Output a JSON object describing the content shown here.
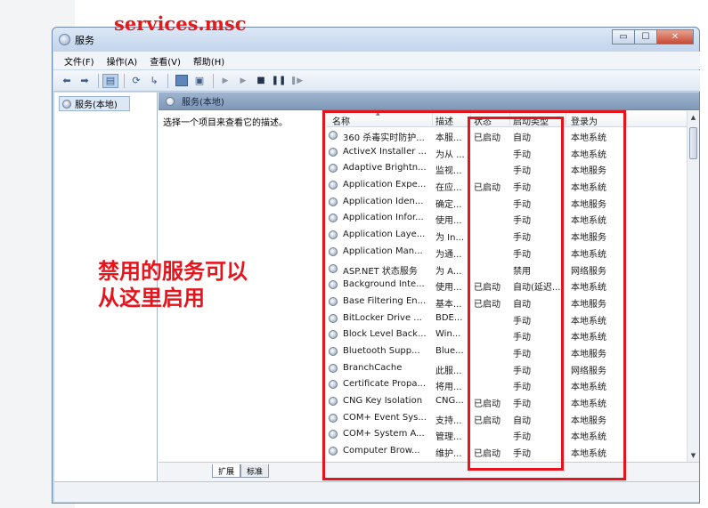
{
  "overlay_title": "services.msc",
  "annotation_line1": "禁用的服务可以",
  "annotation_line2": "从这里启用",
  "window": {
    "title": "服务",
    "min_label": "▭",
    "max_label": "☐",
    "close_label": "✕"
  },
  "menu": [
    "文件(F)",
    "操作(A)",
    "查看(V)",
    "帮助(H)"
  ],
  "tree_item": "服务(本地)",
  "pane_header": "服务(本地)",
  "description_prompt": "选择一个项目来查看它的描述。",
  "columns": {
    "name": "名称",
    "desc": "描述",
    "status": "状态",
    "startup": "启动类型",
    "logon": "登录为"
  },
  "services": [
    {
      "name": "360 杀毒实时防护...",
      "desc": "本服...",
      "status": "已启动",
      "startup": "自动",
      "logon": "本地系统"
    },
    {
      "name": "ActiveX Installer ...",
      "desc": "为从 ...",
      "status": "",
      "startup": "手动",
      "logon": "本地系统"
    },
    {
      "name": "Adaptive Brightn...",
      "desc": "监视...",
      "status": "",
      "startup": "手动",
      "logon": "本地服务"
    },
    {
      "name": "Application Expe...",
      "desc": "在应...",
      "status": "已启动",
      "startup": "手动",
      "logon": "本地系统"
    },
    {
      "name": "Application Iden...",
      "desc": "确定...",
      "status": "",
      "startup": "手动",
      "logon": "本地服务"
    },
    {
      "name": "Application Infor...",
      "desc": "使用...",
      "status": "",
      "startup": "手动",
      "logon": "本地系统"
    },
    {
      "name": "Application Laye...",
      "desc": "为 In...",
      "status": "",
      "startup": "手动",
      "logon": "本地服务"
    },
    {
      "name": "Application Man...",
      "desc": "为通...",
      "status": "",
      "startup": "手动",
      "logon": "本地系统"
    },
    {
      "name": "ASP.NET 状态服务",
      "desc": "为 A...",
      "status": "",
      "startup": "禁用",
      "logon": "网络服务"
    },
    {
      "name": "Background Inte...",
      "desc": "使用...",
      "status": "已启动",
      "startup": "自动(延迟...",
      "logon": "本地系统"
    },
    {
      "name": "Base Filtering En...",
      "desc": "基本...",
      "status": "已启动",
      "startup": "自动",
      "logon": "本地服务"
    },
    {
      "name": "BitLocker Drive ...",
      "desc": "BDE...",
      "status": "",
      "startup": "手动",
      "logon": "本地系统"
    },
    {
      "name": "Block Level Back...",
      "desc": "Win...",
      "status": "",
      "startup": "手动",
      "logon": "本地系统"
    },
    {
      "name": "Bluetooth Supp...",
      "desc": "Blue...",
      "status": "",
      "startup": "手动",
      "logon": "本地服务"
    },
    {
      "name": "BranchCache",
      "desc": "此服...",
      "status": "",
      "startup": "手动",
      "logon": "网络服务"
    },
    {
      "name": "Certificate Propa...",
      "desc": "将用...",
      "status": "",
      "startup": "手动",
      "logon": "本地系统"
    },
    {
      "name": "CNG Key Isolation",
      "desc": "CNG...",
      "status": "已启动",
      "startup": "手动",
      "logon": "本地系统"
    },
    {
      "name": "COM+ Event Sys...",
      "desc": "支持...",
      "status": "已启动",
      "startup": "自动",
      "logon": "本地服务"
    },
    {
      "name": "COM+ System A...",
      "desc": "管理...",
      "status": "",
      "startup": "手动",
      "logon": "本地系统"
    },
    {
      "name": "Computer Brow...",
      "desc": "维护...",
      "status": "已启动",
      "startup": "手动",
      "logon": "本地系统"
    }
  ],
  "tabs": [
    "扩展",
    "标准"
  ]
}
